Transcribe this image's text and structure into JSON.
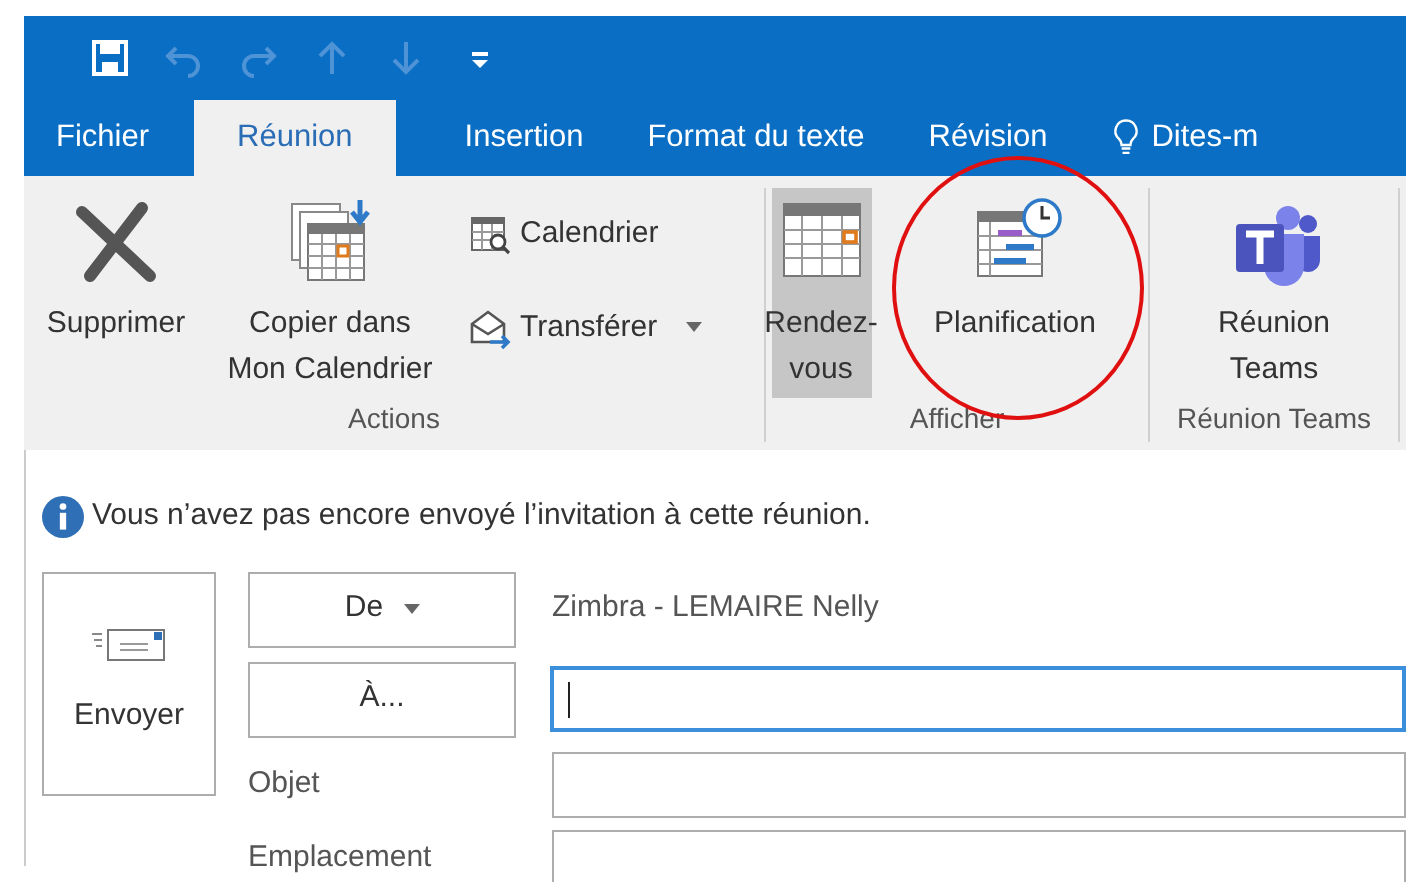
{
  "quick_access": [
    {
      "disabled": false
    },
    {
      "disabled": true
    },
    {
      "disabled": true
    },
    {
      "disabled": true
    },
    {
      "disabled": true
    },
    {
      "disabled": false
    }
  ],
  "tabs": [
    {
      "label": "Fichier",
      "kind": "tab",
      "selected": false
    },
    {
      "label": "Réunion",
      "kind": "tab",
      "selected": true
    },
    {
      "label": "Insertion",
      "kind": "tab",
      "selected": false
    },
    {
      "label": "Format du texte",
      "kind": "tab",
      "selected": false
    },
    {
      "label": "Révision",
      "kind": "tab",
      "selected": false
    },
    {
      "label": "Dites-m",
      "kind": "tell",
      "selected": false
    }
  ],
  "ribbon": [
    {
      "label": "Actions",
      "items": [
        {
          "label": "Supprimer",
          "kind": "large",
          "selected": false
        },
        {
          "label": "Copier dans Mon Calendrier",
          "kind": "large",
          "selected": false
        },
        {
          "label": "Calendrier",
          "kind": "small",
          "dropdown": false
        },
        {
          "label": "Transférer",
          "kind": "small",
          "dropdown": true
        }
      ]
    },
    {
      "label": "Afficher",
      "items": [
        {
          "label": "Rendez-vous",
          "kind": "large",
          "selected": true
        },
        {
          "label": "Planification",
          "kind": "large",
          "selected": false
        }
      ]
    },
    {
      "label": "Réunion Teams",
      "items": [
        {
          "label": "Réunion Teams",
          "kind": "large",
          "selected": false
        }
      ]
    }
  ],
  "highlight_circle": true,
  "info": "Vous n’avez pas encore envoyé l’invitation à cette réunion.",
  "send_button": "Envoyer",
  "from_button": "De",
  "from_value": "Zimbra - LEMAIRE Nelly",
  "to_button": "À...",
  "to_field": {
    "focused": true
  },
  "fields": [
    {
      "label": "Objet"
    },
    {
      "label": "Emplacement"
    }
  ]
}
